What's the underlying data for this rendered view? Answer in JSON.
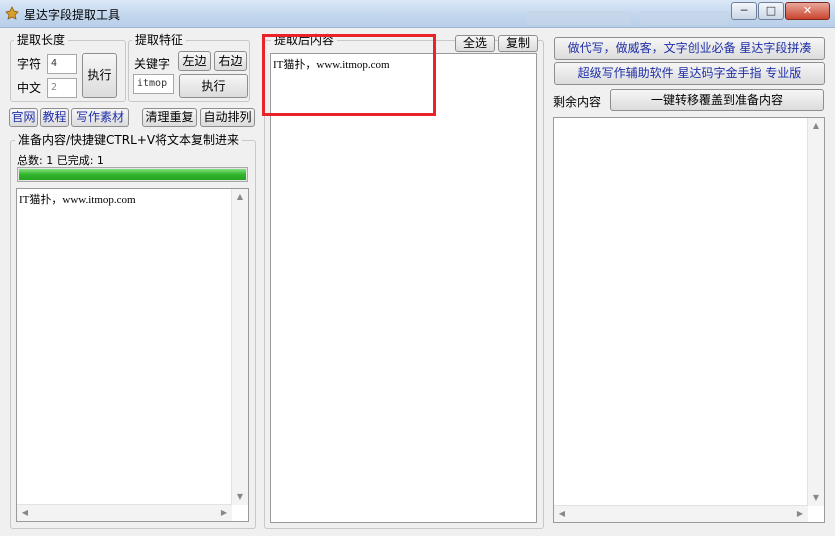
{
  "window": {
    "title": "星达字段提取工具",
    "minimize": "─",
    "maximize": "□",
    "close": "✕"
  },
  "extract_length": {
    "legend": "提取长度",
    "char_label": "字符",
    "char_value": "4",
    "chinese_label": "中文",
    "chinese_value": "2",
    "exec_label": "执行"
  },
  "extract_feature": {
    "legend": "提取特征",
    "keyword_label": "关键字",
    "keyword_value": "itmop",
    "left_label": "左边",
    "right_label": "右边",
    "exec_label": "执行"
  },
  "link_buttons": {
    "website": "官网",
    "tutorial": "教程",
    "material": "写作素材"
  },
  "clean_dup": "清理重复",
  "auto_sort": "自动排列",
  "prepare": {
    "legend": "准备内容/快捷键CTRL+V将文本复制进来",
    "stats": "总数: 1 已完成: 1",
    "progress": 1.0,
    "content": "IT猫扑，www.itmop.com"
  },
  "result": {
    "legend": "提取后内容",
    "select_all": "全选",
    "copy": "复制",
    "content": "IT猫扑，www.itmop.com"
  },
  "ads": {
    "line1": "做代写，做威客，文字创业必备 星达字段拼凑",
    "line2": "超级写作辅助软件 星达码字金手指 专业版"
  },
  "remaining": {
    "label": "剩余内容",
    "transfer": "一键转移覆盖到准备内容"
  },
  "colors": {
    "highlight": "#e8242a",
    "progress": "#30b52c",
    "link": "#1f2fa8"
  }
}
